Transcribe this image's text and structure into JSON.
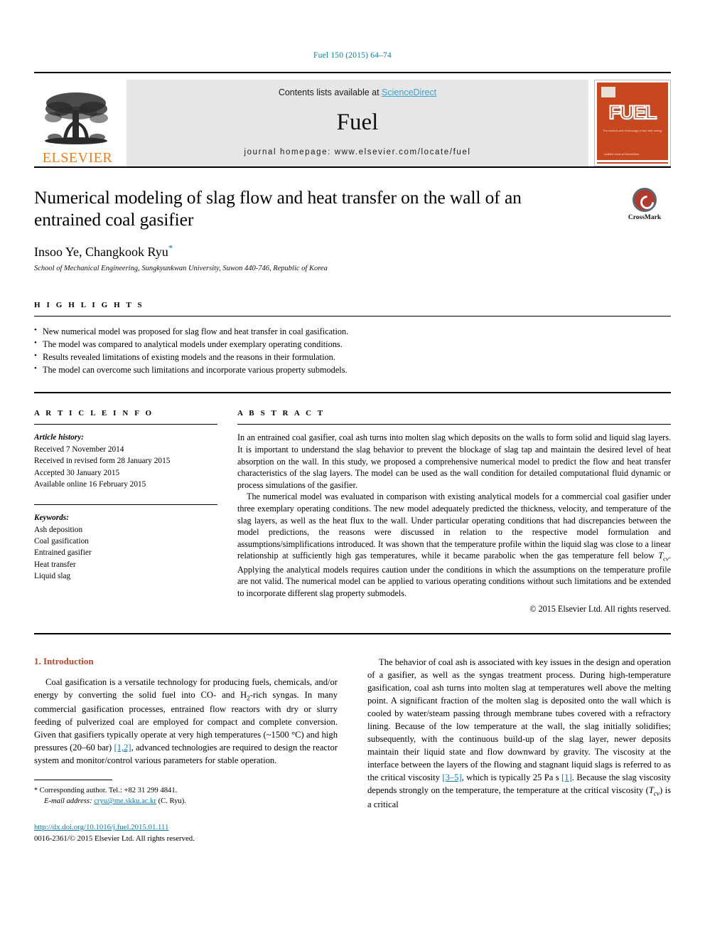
{
  "running_head": "Fuel 150 (2015) 64–74",
  "banner": {
    "publisher_name": "ELSEVIER",
    "contents_prefix": "Contents lists available at ",
    "contents_link": "ScienceDirect",
    "journal_name": "Fuel",
    "homepage": "journal homepage: www.elsevier.com/locate/fuel",
    "cover_title": "FUEL",
    "cover_subtitle": "The science and technology of fuel and energy",
    "cover_footer": "Available online at\nScienceDirect"
  },
  "article": {
    "title": "Numerical modeling of slag flow and heat transfer on the wall of an entrained coal gasifier",
    "authors": "Insoo Ye, Changkook Ryu",
    "corresponding_marker": "*",
    "affiliation": "School of Mechanical Engineering, Sungkyunkwan University, Suwon 440-746, Republic of Korea",
    "crossmark_label": "CrossMark"
  },
  "highlights": {
    "heading": "H I G H L I G H T S",
    "items": [
      "New numerical model was proposed for slag flow and heat transfer in coal gasification.",
      "The model was compared to analytical models under exemplary operating conditions.",
      "Results revealed limitations of existing models and the reasons in their formulation.",
      "The model can overcome such limitations and incorporate various property submodels."
    ]
  },
  "article_info": {
    "heading": "A R T I C L E    I N F O",
    "history_label": "Article history:",
    "history": [
      "Received 7 November 2014",
      "Received in revised form 28 January 2015",
      "Accepted 30 January 2015",
      "Available online 16 February 2015"
    ],
    "keywords_label": "Keywords:",
    "keywords": [
      "Ash deposition",
      "Coal gasification",
      "Entrained gasifier",
      "Heat transfer",
      "Liquid slag"
    ]
  },
  "abstract": {
    "heading": "A B S T R A C T",
    "paragraph1": "In an entrained coal gasifier, coal ash turns into molten slag which deposits on the walls to form solid and liquid slag layers. It is important to understand the slag behavior to prevent the blockage of slag tap and maintain the desired level of heat absorption on the wall. In this study, we proposed a comprehensive numerical model to predict the flow and heat transfer characteristics of the slag layers. The model can be used as the wall condition for detailed computational fluid dynamic or process simulations of the gasifier.",
    "paragraph2_a": "The numerical model was evaluated in comparison with existing analytical models for a commercial coal gasifier under three exemplary operating conditions. The new model adequately predicted the thickness, velocity, and temperature of the slag layers, as well as the heat flux to the wall. Under particular operating conditions that had discrepancies between the model predictions, the reasons were discussed in relation to the respective model formulation and assumptions/simplifications introduced. It was shown that the temperature profile within the liquid slag was close to a linear relationship at sufficiently high gas temperatures, while it became parabolic when the gas temperature fell below ",
    "paragraph2_symbol": "Tcv",
    "paragraph2_b": ". Applying the analytical models requires caution under the conditions in which the assumptions on the temperature profile are not valid. The numerical model can be applied to various operating conditions without such limitations and be extended to incorporate different slag property submodels.",
    "copyright": "© 2015 Elsevier Ltd. All rights reserved."
  },
  "introduction": {
    "heading": "1. Introduction",
    "left_a": "Coal gasification is a versatile technology for producing fuels, chemicals, and/or energy by converting the solid fuel into CO- and H",
    "left_sub": "2",
    "left_b": "-rich syngas. In many commercial gasification processes, entrained flow reactors with dry or slurry feeding of pulverized coal are employed for compact and complete conversion. Given that gasifiers typically operate at very high temperatures (~1500 °C) and high pressures (20–60 bar) ",
    "left_ref": "[1,2]",
    "left_c": ", advanced technologies are required to design the reactor system and monitor/control various parameters for stable operation.",
    "right_a": "The behavior of coal ash is associated with key issues in the design and operation of a gasifier, as well as the syngas treatment process. During high-temperature gasification, coal ash turns into molten slag at temperatures well above the melting point. A significant fraction of the molten slag is deposited onto the wall which is cooled by water/steam passing through membrane tubes covered with a refractory lining. Because of the low temperature at the wall, the slag initially solidifies; subsequently, with the continuous build-up of the slag layer, newer deposits maintain their liquid state and flow downward by gravity. The viscosity at the interface between the layers of the flowing and stagnant liquid slags is referred to as the critical viscosity ",
    "right_ref1": "[3–5]",
    "right_b": ", which is typically 25 Pa s ",
    "right_ref2": "[1]",
    "right_c": ". Because the slag viscosity depends strongly on the temperature, the temperature at the critical viscosity (",
    "right_symbol": "Tcv",
    "right_d": ") is a critical"
  },
  "footer": {
    "corresponding_marker": "*",
    "corresponding": " Corresponding author. Tel.: +82 31 299 4841.",
    "email_label": "E-mail address:",
    "email": "cryu@me.skku.ac.kr",
    "email_suffix": " (C. Ryu).",
    "doi": "http://dx.doi.org/10.1016/j.fuel.2015.01.111",
    "issn_line": "0016-2361/© 2015 Elsevier Ltd. All rights reserved."
  },
  "colors": {
    "link": "#0b7aa8",
    "section_title": "#b0482a",
    "elsevier_orange": "#ef7d1a",
    "sciencedirect": "#3ba2d4"
  }
}
